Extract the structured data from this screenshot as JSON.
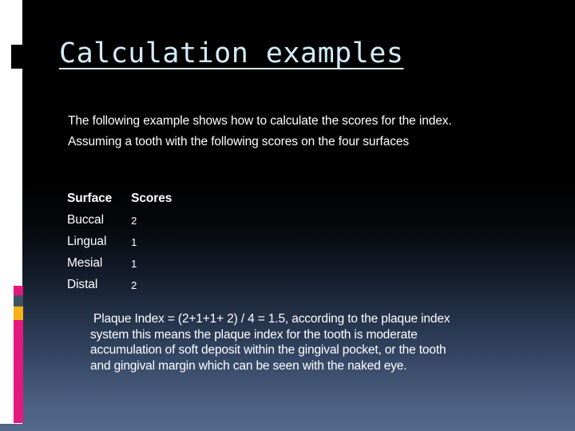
{
  "slide": {
    "title": "Calculation examples",
    "intro_lines": [
      "The following example shows how to calculate the scores for the index.",
      "Assuming a tooth with the following scores on the four surfaces"
    ],
    "table": {
      "headers": [
        "Surface",
        "Scores"
      ],
      "rows": [
        [
          "Buccal",
          "2"
        ],
        [
          "Lingual",
          "1"
        ],
        [
          "Mesial",
          "1"
        ],
        [
          "Distal",
          "2"
        ]
      ]
    },
    "conclusion_lines": [
      "Plaque Index = (2+1+1+ 2) / 4 = 1.5, according to the plaque index",
      "system this means the plaque index for the tooth is moderate",
      "accumulation of soft deposit within the gingival pocket, or the tooth",
      "and gingival margin which can be seen with the naked eye."
    ]
  },
  "theme": {
    "title_color": "#d3ecf9",
    "body_color": "#ffffff",
    "background_top": "#000000",
    "background_bottom": "#55698c",
    "rail_white": "#ffffff",
    "accent_magenta": "#e3197f",
    "accent_slate": "#3f5360",
    "accent_amber": "#f6b117"
  }
}
